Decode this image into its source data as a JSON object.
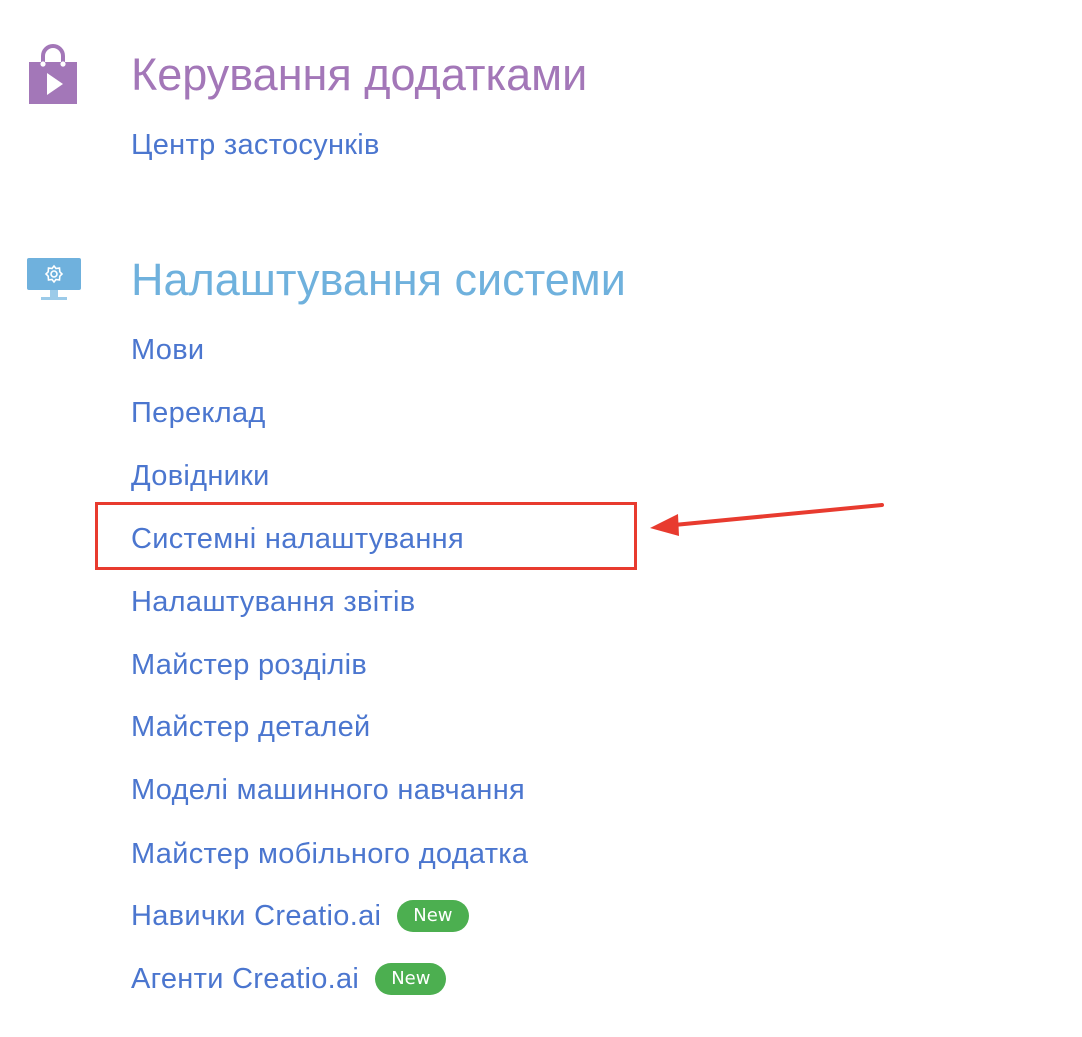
{
  "colors": {
    "app_management_title": "#a377b8",
    "system_settings_title": "#6fb1dd",
    "link": "#4b76cf",
    "badge_bg": "#4caf50",
    "highlight": "#e83b2f"
  },
  "app_management": {
    "icon": "shopping-bag-play-icon",
    "title": "Керування додатками",
    "links": [
      {
        "label": "Центр застосунків"
      }
    ]
  },
  "system_settings": {
    "icon": "monitor-gear-icon",
    "title": "Налаштування системи",
    "links": [
      {
        "label": "Мови"
      },
      {
        "label": "Переклад"
      },
      {
        "label": "Довідники"
      },
      {
        "label": "Системні налаштування"
      },
      {
        "label": "Налаштування звітів"
      },
      {
        "label": "Майстер розділів"
      },
      {
        "label": "Майстер деталей"
      },
      {
        "label": "Моделі машинного навчання"
      },
      {
        "label": "Майстер мобільного додатка"
      },
      {
        "label": "Навички Creatio.ai",
        "badge": "New"
      },
      {
        "label": "Агенти Creatio.ai",
        "badge": "New"
      }
    ]
  }
}
